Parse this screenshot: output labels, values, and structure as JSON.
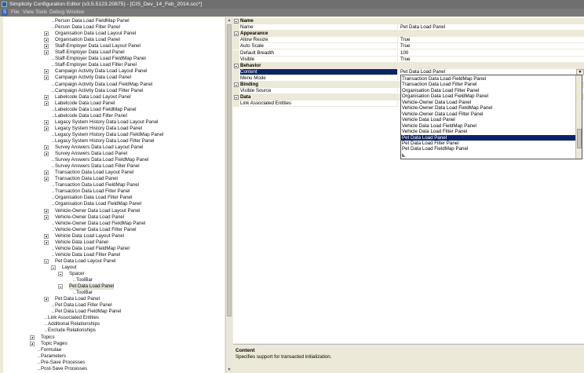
{
  "window": {
    "title": "Simplicity Configuration Editor (v3.5.5123.20875) - [CIS_Dev_14_Feb_2014.scc*]"
  },
  "menu": {
    "logo": "S",
    "items": [
      "File",
      "View",
      "Tools",
      "Debug",
      "Window"
    ]
  },
  "tree": {
    "items": [
      {
        "label": "Person Data Load FieldMap Panel",
        "toggle": "none"
      },
      {
        "label": "Person Data Load Filter Panel",
        "toggle": "none"
      },
      {
        "label": "Organisation Data Load Layout Panel",
        "toggle": "plus"
      },
      {
        "label": "Organisation Data Load Panel",
        "toggle": "plus"
      },
      {
        "label": "Staff-Employer Data Load Layout Panel",
        "toggle": "plus"
      },
      {
        "label": "Staff-Employer Data Load Panel",
        "toggle": "plus"
      },
      {
        "label": "Staff-Employer Data Load FieldMap Panel",
        "toggle": "none"
      },
      {
        "label": "Staff-Employer Data Load Filter Panel",
        "toggle": "none"
      },
      {
        "label": "Campaign Activity Data Load Layout Panel",
        "toggle": "plus"
      },
      {
        "label": "Campaign Activity Data Load Panel",
        "toggle": "plus"
      },
      {
        "label": "Campaign Activity Data Load FieldMap Panel",
        "toggle": "none"
      },
      {
        "label": "Campaign Activity Data Load Filter Panel",
        "toggle": "none"
      },
      {
        "label": "Labelcode Data Load Layout Panel",
        "toggle": "plus"
      },
      {
        "label": "Labelcode Data Load Panel",
        "toggle": "plus"
      },
      {
        "label": "Labelcode Data Load FieldMap Panel",
        "toggle": "none"
      },
      {
        "label": "Labelcode Data Load Filter Panel",
        "toggle": "none"
      },
      {
        "label": "Legacy System History Data Load Layout Panel",
        "toggle": "plus"
      },
      {
        "label": "Legacy System History Data Load Panel",
        "toggle": "plus"
      },
      {
        "label": "Legacy System History Data Load FieldMap Panel",
        "toggle": "none"
      },
      {
        "label": "Legacy System History Data Load Filter Panel",
        "toggle": "none"
      },
      {
        "label": "Survey Answers Data Load Layout Panel",
        "toggle": "plus"
      },
      {
        "label": "Survey Answers Data Load Panel",
        "toggle": "plus"
      },
      {
        "label": "Survey Answers Data Load FieldMap Panel",
        "toggle": "none"
      },
      {
        "label": "Survey Answers Data Load Filter Panel",
        "toggle": "none"
      },
      {
        "label": "Transaction Data Load Layout Panel",
        "toggle": "plus"
      },
      {
        "label": "Transaction Data Load Panel",
        "toggle": "plus"
      },
      {
        "label": "Transaction Data Load FieldMap Panel",
        "toggle": "none"
      },
      {
        "label": "Transaction Data Load Filter Panel",
        "toggle": "none"
      },
      {
        "label": "Organisation Data Load Filter Panel",
        "toggle": "none"
      },
      {
        "label": "Organisation Data Load FieldMap Panel",
        "toggle": "none"
      },
      {
        "label": "Vehicle-Owner Data Load Layout Panel",
        "toggle": "plus"
      },
      {
        "label": "Vehicle-Owner Data Load Panel",
        "toggle": "plus"
      },
      {
        "label": "Vehicle-Owner Data Load FieldMap Panel",
        "toggle": "none"
      },
      {
        "label": "Vehicle-Owner Data Load Filter Panel",
        "toggle": "none"
      },
      {
        "label": "Vehicle Data Load Layout Panel",
        "toggle": "plus"
      },
      {
        "label": "Vehicle Data Load Panel",
        "toggle": "plus"
      },
      {
        "label": "Vehicle Data Load FieldMap Panel",
        "toggle": "none"
      },
      {
        "label": "Vehicle Data Load Filter Panel",
        "toggle": "none"
      },
      {
        "label": "Pet Data Load Layout Panel",
        "toggle": "minus"
      },
      {
        "label": "Layout",
        "toggle": "minus",
        "depth": 1
      },
      {
        "label": "Spacer",
        "toggle": "minus",
        "depth": 2
      },
      {
        "label": "ToolBar",
        "toggle": "none",
        "depth": 3
      },
      {
        "label": "Pet Data Load Panel",
        "toggle": "minus",
        "depth": 2,
        "selected": true
      },
      {
        "label": "ToolBar",
        "toggle": "none",
        "depth": 3
      },
      {
        "label": "Pet Data Load Panel",
        "toggle": "plus"
      },
      {
        "label": "Pet Data Load Filter Panel",
        "toggle": "none"
      },
      {
        "label": "Pet Data Load FieldMap Panel",
        "toggle": "none"
      },
      {
        "label": "Link Associated Entities",
        "toggle": "none",
        "depth": -1
      },
      {
        "label": "Additional Relationships",
        "toggle": "none",
        "depth": -1
      },
      {
        "label": "Exclude Relationships",
        "toggle": "none",
        "depth": -1
      },
      {
        "label": "Topics",
        "toggle": "plus",
        "depth": -2
      },
      {
        "label": "Topic Pages",
        "toggle": "plus",
        "depth": -2
      },
      {
        "label": "Formulae",
        "toggle": "none",
        "depth": -2
      },
      {
        "label": "Parameters",
        "toggle": "none",
        "depth": -2
      },
      {
        "label": "Pre-Save Processes",
        "toggle": "none",
        "depth": -2
      },
      {
        "label": "Post-Save Processes",
        "toggle": "none",
        "depth": -2
      }
    ]
  },
  "properties": {
    "rows": [
      {
        "type": "cat",
        "name": "Name"
      },
      {
        "type": "prop",
        "name": "Name",
        "value": "Pet Data Load Panel"
      },
      {
        "type": "cat",
        "name": "Appearance"
      },
      {
        "type": "prop",
        "name": "Allow Resize",
        "value": "True"
      },
      {
        "type": "prop",
        "name": "Auto Scale",
        "value": "True"
      },
      {
        "type": "prop",
        "name": "Default Breadth",
        "value": "100"
      },
      {
        "type": "prop",
        "name": "Visible",
        "value": "True"
      },
      {
        "type": "cat",
        "name": "Behavior"
      },
      {
        "type": "prop",
        "name": "Content",
        "value": "Pet Data Load Panel",
        "selected": true
      },
      {
        "type": "prop",
        "name": "Menu Mode",
        "value": ""
      },
      {
        "type": "cat",
        "name": "Binding"
      },
      {
        "type": "prop",
        "name": "Visible Source",
        "value": ""
      },
      {
        "type": "cat",
        "name": "Data"
      },
      {
        "type": "prop",
        "name": "Link Associated Entities",
        "value": ""
      }
    ]
  },
  "dropdown": {
    "items": [
      "Transaction Data Load FieldMap Panel",
      "Transaction Data Load Filter Panel",
      "Organisation Data Load Filter Panel",
      "Organisation Data Load FieldMap Panel",
      "Vehicle-Owner Data Load Panel",
      "Vehicle-Owner Data Load FieldMap Panel",
      "Vehicle-Owner Data Load Filter Panel",
      "Vehicle Data Load Panel",
      "Vehicle Data Load FieldMap Panel",
      "Vehicle Data Load Filter Panel",
      "Pet Data Load Panel",
      "Pet Data Load Filter Panel",
      "Pet Data Load FieldMap Panel"
    ],
    "selected_index": 10
  },
  "help": {
    "title": "Content",
    "description": "Specifies support for transacted initialization."
  }
}
